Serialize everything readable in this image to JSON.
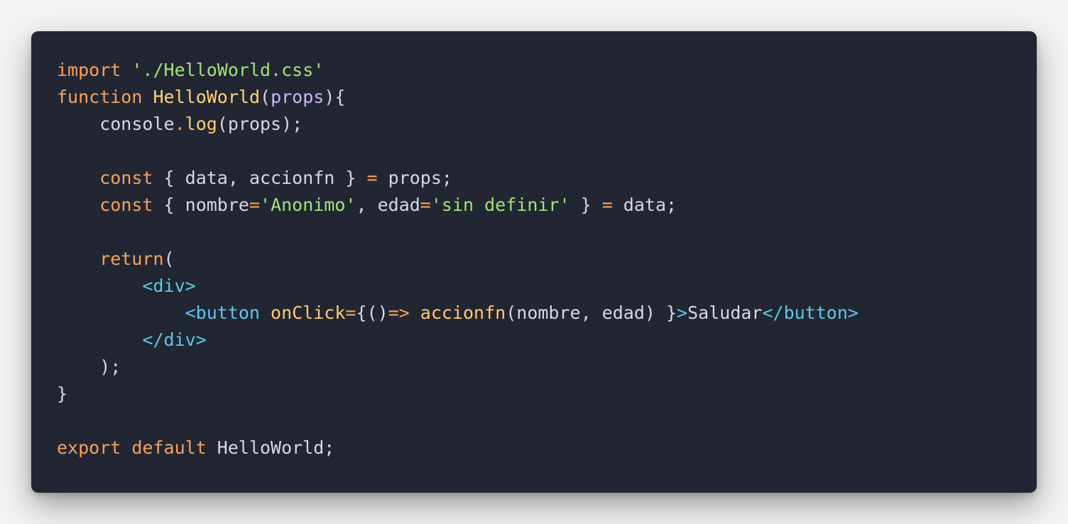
{
  "colors": {
    "keyword": "#f3a35f",
    "string": "#a6e07a",
    "funcname": "#ffd27a",
    "param": "#cdb7f5",
    "plain": "#d6d9e0",
    "operator": "#f3a35f",
    "tag": "#5ec8ea",
    "call": "#ffcc70"
  },
  "lines": [
    [
      [
        "keyword",
        "import"
      ],
      [
        "plain",
        " "
      ],
      [
        "string",
        "'./HelloWorld.css'"
      ]
    ],
    [
      [
        "keyword",
        "function"
      ],
      [
        "plain",
        " "
      ],
      [
        "funcname",
        "HelloWorld"
      ],
      [
        "plain",
        "("
      ],
      [
        "param",
        "props"
      ],
      [
        "plain",
        "){"
      ]
    ],
    [
      [
        "plain",
        "    console"
      ],
      [
        "operator",
        "."
      ],
      [
        "call",
        "log"
      ],
      [
        "plain",
        "(props);"
      ]
    ],
    [],
    [
      [
        "plain",
        "    "
      ],
      [
        "keyword",
        "const"
      ],
      [
        "plain",
        " { data, accionfn } "
      ],
      [
        "operator",
        "="
      ],
      [
        "plain",
        " props;"
      ]
    ],
    [
      [
        "plain",
        "    "
      ],
      [
        "keyword",
        "const"
      ],
      [
        "plain",
        " { nombre"
      ],
      [
        "operator",
        "="
      ],
      [
        "string",
        "'Anonimo'"
      ],
      [
        "plain",
        ", edad"
      ],
      [
        "operator",
        "="
      ],
      [
        "string",
        "'sin definir'"
      ],
      [
        "plain",
        " } "
      ],
      [
        "operator",
        "="
      ],
      [
        "plain",
        " data;"
      ]
    ],
    [],
    [
      [
        "plain",
        "    "
      ],
      [
        "keyword",
        "return"
      ],
      [
        "plain",
        "("
      ]
    ],
    [
      [
        "plain",
        "        "
      ],
      [
        "tag",
        "<div>"
      ]
    ],
    [
      [
        "plain",
        "            "
      ],
      [
        "tag",
        "<button"
      ],
      [
        "plain",
        " "
      ],
      [
        "call",
        "onClick"
      ],
      [
        "operator",
        "="
      ],
      [
        "plain",
        "{()"
      ],
      [
        "operator",
        "=>"
      ],
      [
        "plain",
        " "
      ],
      [
        "call",
        "accionfn"
      ],
      [
        "plain",
        "(nombre, edad) }"
      ],
      [
        "tag",
        ">"
      ],
      [
        "plain",
        "Saludar"
      ],
      [
        "tag",
        "</button>"
      ]
    ],
    [
      [
        "plain",
        "        "
      ],
      [
        "tag",
        "</div>"
      ]
    ],
    [
      [
        "plain",
        "    );"
      ]
    ],
    [
      [
        "plain",
        "}"
      ]
    ],
    [],
    [
      [
        "keyword",
        "export"
      ],
      [
        "plain",
        " "
      ],
      [
        "keyword",
        "default"
      ],
      [
        "plain",
        " HelloWorld;"
      ]
    ]
  ]
}
